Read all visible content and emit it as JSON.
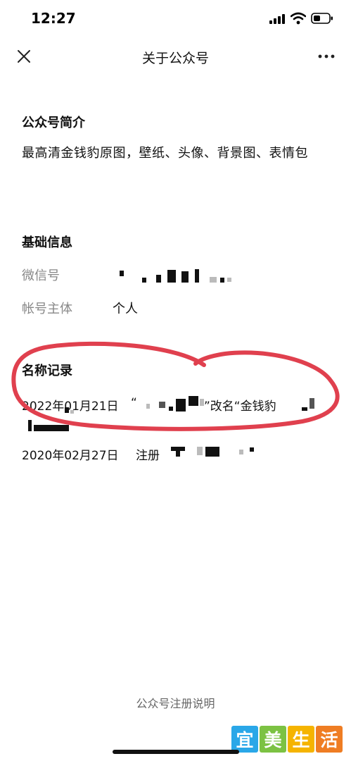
{
  "status": {
    "time": "12:27"
  },
  "nav": {
    "title": "关于公众号",
    "close_icon": "close-icon",
    "more_icon": "more-dots-icon"
  },
  "intro": {
    "heading": "公众号简介",
    "text": "最高清金钱豹原图，壁纸、头像、背景图、表情包"
  },
  "basic_info": {
    "heading": "基础信息",
    "wechat_id_label": "微信号",
    "owner_label": "帐号主体",
    "owner_value": "个人"
  },
  "name_history": {
    "heading": "名称记录",
    "records": [
      {
        "date": "2022年01月21日",
        "open_quote": "“",
        "mid": "”改名“金钱豹"
      },
      {
        "date": "2020年02月27日",
        "action": "注册"
      }
    ]
  },
  "footer": {
    "link": "公众号注册说明"
  },
  "watermark": {
    "chars": [
      "宜",
      "美",
      "生",
      "活"
    ],
    "colors": [
      "#2aa7e8",
      "#7cc243",
      "#f5b400",
      "#ef7d23"
    ]
  },
  "annotation_color": "#e0404e"
}
